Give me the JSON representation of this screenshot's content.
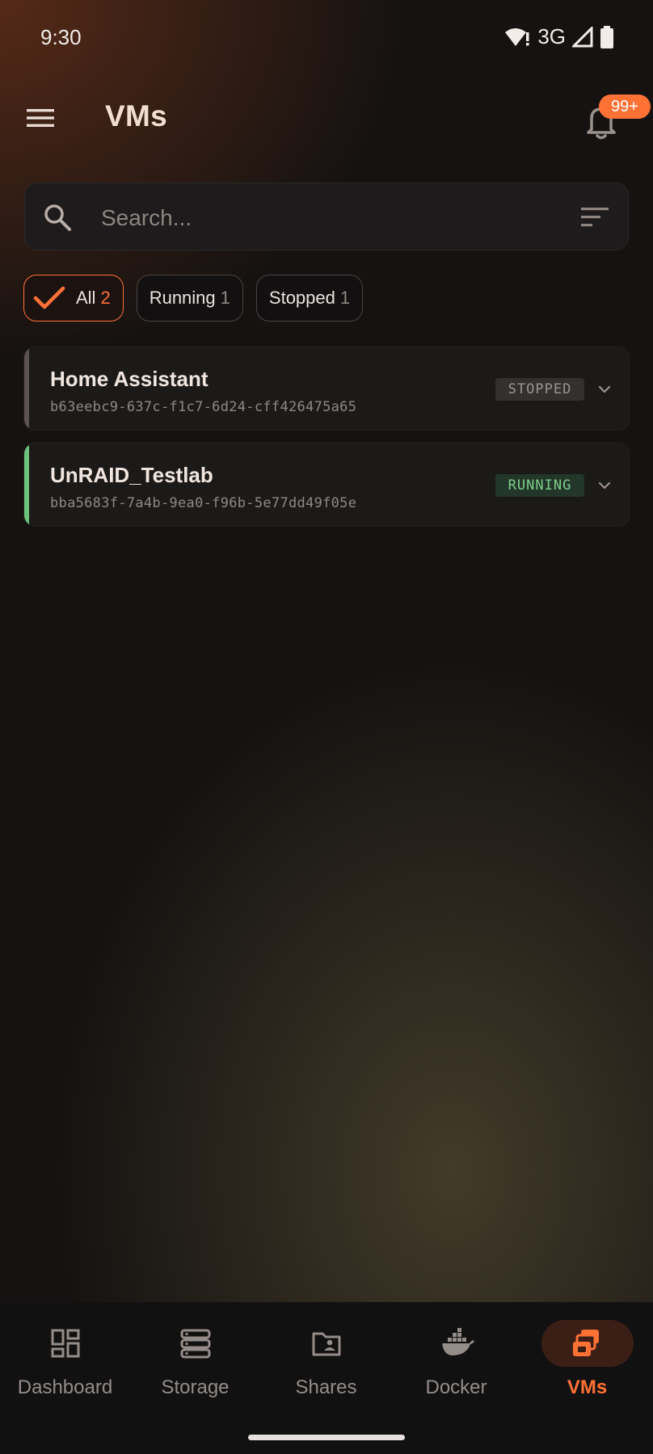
{
  "status_bar": {
    "time": "9:30",
    "network": "3G",
    "icons": [
      "wifi-alert-icon",
      "signal-icon",
      "battery-icon"
    ]
  },
  "app_bar": {
    "title": "VMs",
    "notification_badge": "99+",
    "icons": [
      "hamburger-menu-icon",
      "bell-icon"
    ]
  },
  "search": {
    "placeholder": "Search...",
    "value": "",
    "icons": [
      "search-icon",
      "sort-filter-icon"
    ]
  },
  "filters": [
    {
      "label": "All",
      "count": "2",
      "selected": true
    },
    {
      "label": "Running",
      "count": "1",
      "selected": false
    },
    {
      "label": "Stopped",
      "count": "1",
      "selected": false
    }
  ],
  "vms": [
    {
      "name": "Home Assistant",
      "uuid": "b63eebc9-637c-f1c7-6d24-cff426475a65",
      "status": "STOPPED",
      "accent_color": "#5b5350"
    },
    {
      "name": "UnRAID_Testlab",
      "uuid": "bba5683f-7a4b-9ea0-f96b-5e77dd49f05e",
      "status": "RUNNING",
      "accent_color": "#6cc27a"
    }
  ],
  "bottom_nav": [
    {
      "label": "Dashboard",
      "icon": "dashboard-icon",
      "active": false
    },
    {
      "label": "Storage",
      "icon": "storage-icon",
      "active": false
    },
    {
      "label": "Shares",
      "icon": "shares-folder-icon",
      "active": false
    },
    {
      "label": "Docker",
      "icon": "docker-whale-icon",
      "active": false
    },
    {
      "label": "VMs",
      "icon": "vms-icon",
      "active": true
    }
  ],
  "colors": {
    "accent": "#ff7135",
    "running": "#7fce8a",
    "stopped": "#9c9490",
    "background": "#151211"
  }
}
